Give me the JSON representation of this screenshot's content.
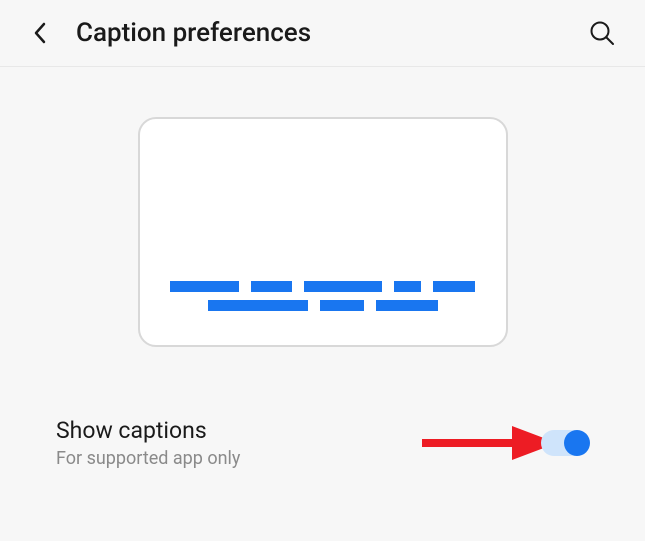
{
  "header": {
    "title": "Caption preferences"
  },
  "settings": {
    "show_captions": {
      "title": "Show captions",
      "subtitle": "For supported app only",
      "enabled": true
    }
  },
  "colors": {
    "accent": "#1976f0",
    "arrow": "#ed1c24"
  }
}
